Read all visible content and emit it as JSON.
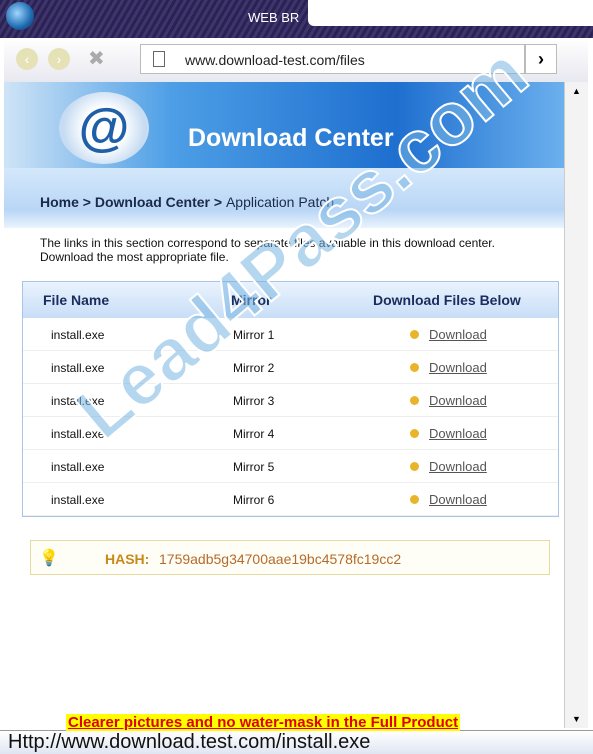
{
  "window": {
    "title": "WEB BR"
  },
  "nav": {
    "back": "‹",
    "forward": "›",
    "stop": "✖",
    "url": "www.download-test.com/files",
    "go": "›"
  },
  "banner": {
    "title": "Download Center",
    "logo": "@"
  },
  "breadcrumb": {
    "home": "Home",
    "sep1": " > ",
    "section": "Download Center",
    "sep2": " > ",
    "current": "Application Patch"
  },
  "description": "The links in this section correspond to separate files available in this download center. Download the most appropriate file.",
  "table": {
    "headers": [
      "File Name",
      "Mirror",
      "Download Files Below"
    ],
    "rows": [
      {
        "file": "install.exe",
        "mirror": "Mirror 1",
        "link": "Download"
      },
      {
        "file": "install.exe",
        "mirror": "Mirror 2",
        "link": "Download"
      },
      {
        "file": "install.exe",
        "mirror": "Mirror 3",
        "link": "Download"
      },
      {
        "file": "install.exe",
        "mirror": "Mirror 4",
        "link": "Download"
      },
      {
        "file": "install.exe",
        "mirror": "Mirror 5",
        "link": "Download"
      },
      {
        "file": "install.exe",
        "mirror": "Mirror 6",
        "link": "Download"
      }
    ]
  },
  "hash": {
    "label": "HASH:",
    "value": "1759adb5g34700aae19bc4578fc19cc2",
    "icon": "lightbulb-icon"
  },
  "watermark": "Lead4Pass.com",
  "promo": "Clearer pictures and no water-mask in the Full Product",
  "status": "Http://www.download.test.com/install.exe"
}
